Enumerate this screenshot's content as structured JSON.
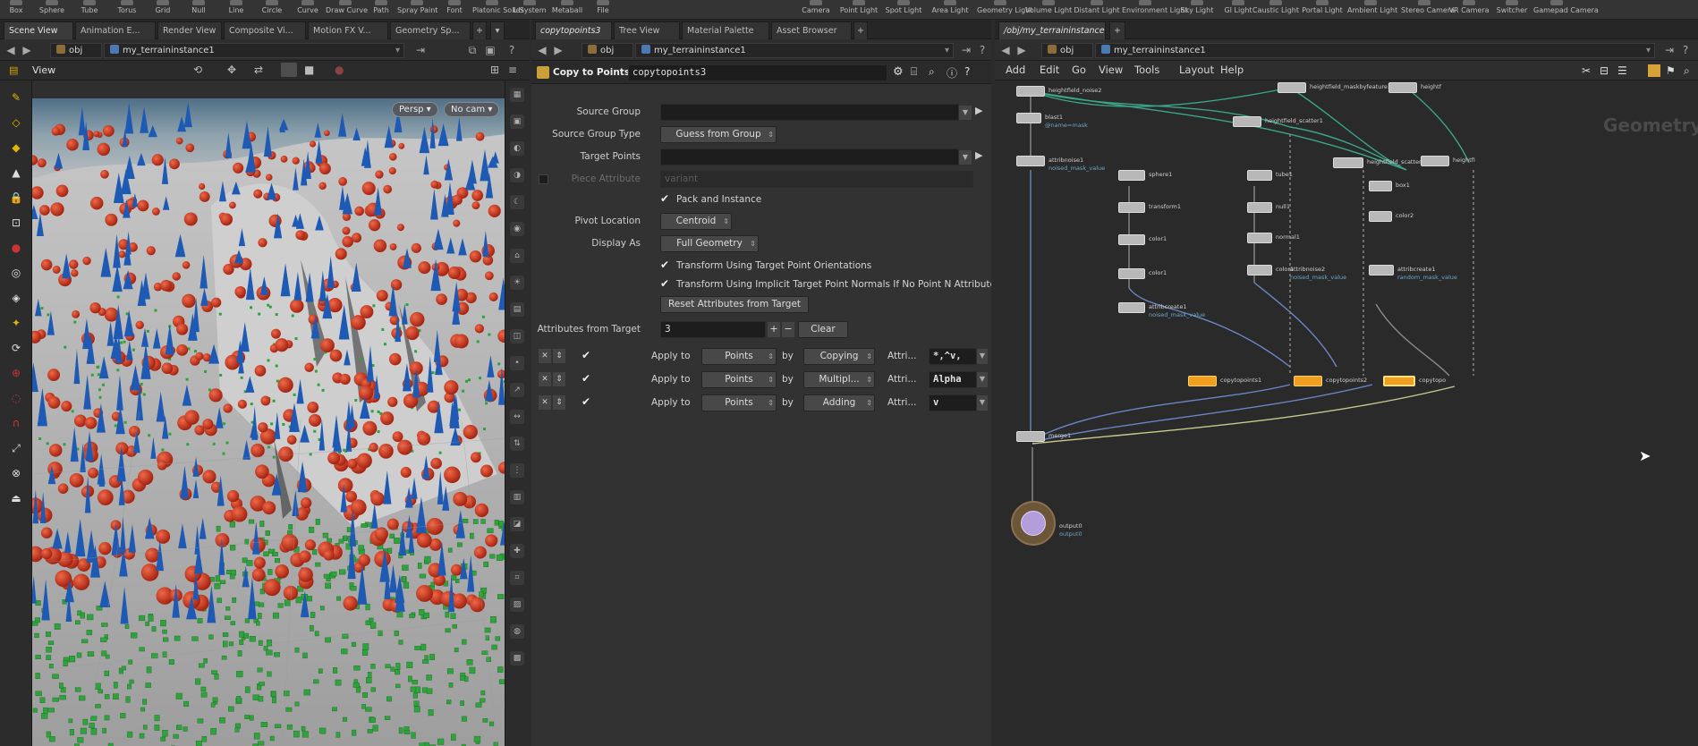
{
  "shelf": {
    "left_tools": [
      "Box",
      "Sphere",
      "Tube",
      "Torus",
      "Grid",
      "Null",
      "Line",
      "Circle",
      "Curve",
      "Draw Curve",
      "Path",
      "Spray Paint",
      "Font",
      "Platonic Solids",
      "L-System",
      "Metaball",
      "File"
    ],
    "right_tools": [
      "Camera",
      "Point Light",
      "Spot Light",
      "Area Light",
      "Geometry Light",
      "Volume Light",
      "Distant Light",
      "Environment Light",
      "Sky Light",
      "GI Light",
      "Caustic Light",
      "Portal Light",
      "Ambient Light",
      "Stereo Camera",
      "VR Camera",
      "Switcher",
      "Gamepad Camera"
    ]
  },
  "left_pane": {
    "tabs": [
      "Scene View",
      "Animation E...",
      "Render View",
      "Composite Vi...",
      "Motion FX V...",
      "Geometry Sp..."
    ],
    "path_root": "obj",
    "path_node": "my_terraininstance1",
    "view_label": "View",
    "persp_label": "Persp ▾",
    "cam_label": "No cam ▾"
  },
  "param_pane": {
    "tabs": [
      "copytopoints3",
      "Tree View",
      "Material Palette",
      "Asset Browser"
    ],
    "path_root": "obj",
    "path_node": "my_terraininstance1",
    "node_type": "Copy to Points",
    "node_name": "copytopoints3",
    "source_group_label": "Source Group",
    "source_group_value": "",
    "source_group_type_label": "Source Group Type",
    "source_group_type_value": "Guess from Group",
    "target_points_label": "Target Points",
    "target_points_value": "",
    "piece_attribute_label": "Piece Attribute",
    "piece_attribute_value": "variant",
    "pack_instance_label": "Pack and Instance",
    "pivot_location_label": "Pivot Location",
    "pivot_location_value": "Centroid",
    "display_as_label": "Display As",
    "display_as_value": "Full Geometry",
    "transform_orient_label": "Transform Using Target Point Orientations",
    "transform_normals_label": "Transform Using Implicit Target Point Normals If No Point N Attribute",
    "reset_attributes_label": "Reset Attributes from Target",
    "attributes_from_target_label": "Attributes from Target",
    "attributes_from_target_value": "3",
    "clear_label": "Clear",
    "attr_rows": [
      {
        "apply_to_label": "Apply to",
        "apply_to": "Points",
        "by_label": "by",
        "method": "Copying",
        "attrib_label": "Attri...",
        "attrib": "*,^v,"
      },
      {
        "apply_to_label": "Apply to",
        "apply_to": "Points",
        "by_label": "by",
        "method": "Multipl...",
        "attrib_label": "Attri...",
        "attrib": "Alpha"
      },
      {
        "apply_to_label": "Apply to",
        "apply_to": "Points",
        "by_label": "by",
        "method": "Adding",
        "attrib_label": "Attri...",
        "attrib": "v"
      }
    ]
  },
  "network_pane": {
    "tab": "/obj/my_terraininstance1",
    "path_root": "obj",
    "path_node": "my_terraininstance1",
    "menu": [
      "Add",
      "Edit",
      "Go",
      "View",
      "Tools",
      "Layout",
      "Help"
    ],
    "watermark": "Geometry",
    "nodes": [
      {
        "label": "heightfield_noise2",
        "sub": ""
      },
      {
        "label": "heightfield_maskbyfeature1",
        "sub": ""
      },
      {
        "label": "heightf",
        "sub": ""
      },
      {
        "label": "blast1",
        "sub": "@name=mask"
      },
      {
        "label": "heightfield_scatter1",
        "sub": ""
      },
      {
        "label": "attribnoise1",
        "sub": "noised_mask_value"
      },
      {
        "label": "heightfield_scatter2",
        "sub": ""
      },
      {
        "label": "heightfi",
        "sub": ""
      },
      {
        "label": "sphere1",
        "sub": ""
      },
      {
        "label": "tube1",
        "sub": ""
      },
      {
        "label": "box1",
        "sub": ""
      },
      {
        "label": "transform1",
        "sub": ""
      },
      {
        "label": "null1",
        "sub": ""
      },
      {
        "label": "color1",
        "sub": ""
      },
      {
        "label": "normal1",
        "sub": ""
      },
      {
        "label": "color2",
        "sub": ""
      },
      {
        "label": "color1",
        "sub": ""
      },
      {
        "label": "color1",
        "sub": ""
      },
      {
        "label": "attribcreate1",
        "sub": "random_mask_value"
      },
      {
        "label": "attribcreate1",
        "sub": "noised_mask_value"
      },
      {
        "label": "attribnoise2",
        "sub": "noised_mask_value"
      },
      {
        "label": "copytopoints1",
        "sub": ""
      },
      {
        "label": "copytopoints2",
        "sub": ""
      },
      {
        "label": "copytopo",
        "sub": ""
      },
      {
        "label": "merge1",
        "sub": ""
      },
      {
        "label": "output0",
        "sub": "output0"
      }
    ]
  },
  "colors": {
    "accent_orange": "#f0a020",
    "node_grey": "#b8b8b8",
    "wire_teal": "#3aa58a",
    "wire_blue": "#6a86c4",
    "sphere_red": "#c8321e",
    "cone_blue": "#1e5ab4",
    "cube_green": "#2ea33c"
  }
}
